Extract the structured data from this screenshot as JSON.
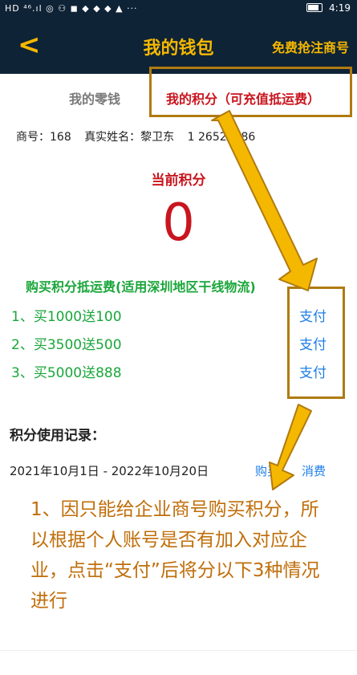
{
  "status_bar": {
    "left_icons": "HD ⁴⁶.ıl ◎ ⚇ ◼ ◆ ◆ ◆ ▲ ···",
    "time": "4:19"
  },
  "nav": {
    "back_icon": "chevron-left-icon",
    "title": "我的钱包",
    "right_link": "免费抢注商号"
  },
  "tabs": [
    {
      "label": "我的零钱",
      "active": false
    },
    {
      "label": "我的积分（可充值抵运费）",
      "active": true
    }
  ],
  "account": {
    "merchant_label": "商号：168",
    "name_label": "真实姓名：黎卫东",
    "phone": "1    26520386"
  },
  "points": {
    "label": "当前积分",
    "value": "0"
  },
  "buy": {
    "title": "购买积分抵运费(适用深圳地区干线物流)",
    "offers": [
      {
        "label": "1、买1000送100",
        "pay": "支付"
      },
      {
        "label": "2、买3500送500",
        "pay": "支付"
      },
      {
        "label": "3、买5000送888",
        "pay": "支付"
      }
    ]
  },
  "records": {
    "title": "积分使用记录：",
    "date_range": "2021年10月1日 - 2022年10月20日",
    "tab_buy": "购买",
    "tab_consume": "消费"
  },
  "note": "1、因只能给企业商号购买积分，所以根据个人账号是否有加入对应企业，点击“支付”后将分以下3种情况进行",
  "colors": {
    "nav_bg": "#0f2336",
    "accent_gold": "#f5b800",
    "red": "#c9151e",
    "green": "#1aa63a",
    "link_blue": "#1d7de8",
    "annotation": "#b07a10"
  }
}
